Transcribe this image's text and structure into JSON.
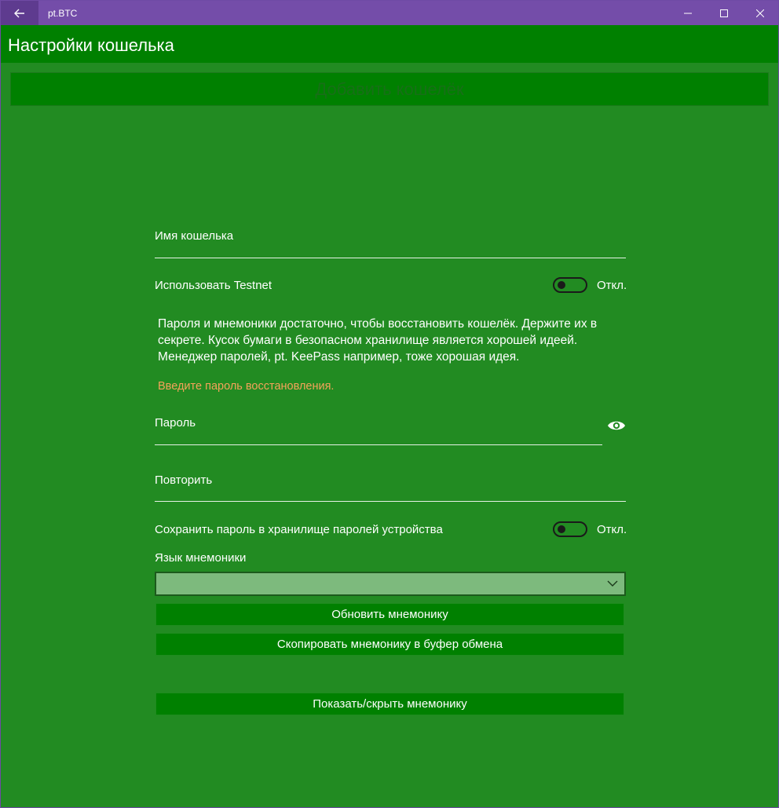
{
  "titlebar": {
    "app_title": "pt.BTC",
    "back_icon": "arrow-left-icon",
    "controls": [
      "minimize-icon",
      "maximize-icon",
      "close-icon"
    ]
  },
  "header": {
    "title": "Настройки кошелька"
  },
  "add_wallet_label": "Добавить кошелёк",
  "form": {
    "wallet_name_label": "Имя кошелька",
    "wallet_name_value": "",
    "testnet_label": "Использовать Testnet",
    "testnet_state": "Откл.",
    "info_text": "Пароля и мнемоники достаточно, чтобы восстановить кошелёк. Держите их в секрете. Кусок бумаги в безопасном хранилище является хорошей идеей. Менеджер паролей, pt. KeePass например, тоже хорошая идея.",
    "warning_text": "Введите пароль восстановления.",
    "password_label": "Пароль",
    "password_value": "",
    "repeat_label": "Повторить",
    "repeat_value": "",
    "save_password_label": "Сохранить пароль в хранилище паролей устройства",
    "save_password_state": "Откл.",
    "mnemonic_language_label": "Язык мнемоники",
    "mnemonic_language_value": "",
    "refresh_mnemonic_label": "Обновить мнемонику",
    "copy_mnemonic_label": "Скопировать мнемонику в буфер обмена",
    "toggle_mnemonic_label": "Показать/скрыть мнемонику"
  },
  "colors": {
    "titlebar": "#744da9",
    "background": "#228b22",
    "header": "#008000",
    "warning": "#f5a35a"
  }
}
